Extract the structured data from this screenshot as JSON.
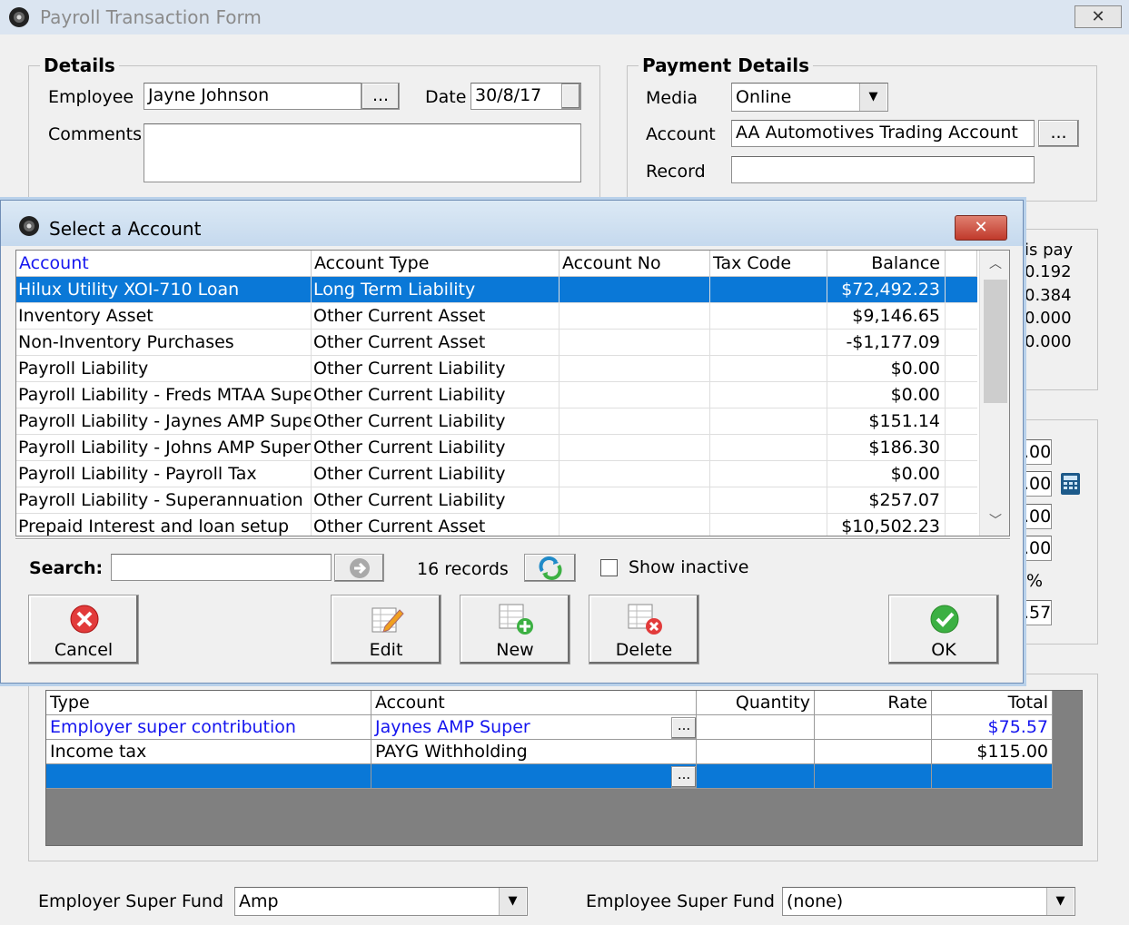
{
  "window": {
    "title": "Payroll Transaction Form",
    "close_glyph": "✕"
  },
  "details": {
    "legend": "Details",
    "employee_label": "Employee",
    "employee_value": "Jayne Johnson",
    "browse_glyph": "...",
    "date_label": "Date",
    "date_value": "30/8/17",
    "comments_label": "Comments",
    "comments_value": ""
  },
  "payment": {
    "legend": "Payment Details",
    "media_label": "Media",
    "media_value": "Online",
    "account_label": "Account",
    "account_value": "AA Automotives Trading Account",
    "record_label": "Record",
    "record_value": ""
  },
  "background_fragments": {
    "pay_header": "is pay",
    "pay_values": [
      "0.192",
      "0.384",
      "0.000",
      "0.000"
    ],
    "amount_values": [
      ".00",
      ".00",
      ".00",
      ".00",
      "%",
      ".57"
    ]
  },
  "dialog": {
    "title": "Select a Account",
    "close_glyph": "✕",
    "columns": [
      "Account",
      "Account Type",
      "Account No",
      "Tax Code",
      "Balance"
    ],
    "rows": [
      {
        "account": "Hilux Utility XOI-710 Loan",
        "type": "Long Term Liability",
        "no": "",
        "tax": "",
        "balance": "$72,492.23",
        "selected": true
      },
      {
        "account": "Inventory Asset",
        "type": "Other Current Asset",
        "no": "",
        "tax": "",
        "balance": "$9,146.65"
      },
      {
        "account": "Non-Inventory Purchases",
        "type": "Other Current Asset",
        "no": "",
        "tax": "",
        "balance": "-$1,177.09"
      },
      {
        "account": "Payroll Liability",
        "type": "Other Current Liability",
        "no": "",
        "tax": "",
        "balance": "$0.00"
      },
      {
        "account": "Payroll Liability - Freds MTAA Super",
        "type": "Other Current Liability",
        "no": "",
        "tax": "",
        "balance": "$0.00"
      },
      {
        "account": "Payroll Liability - Jaynes AMP Super",
        "type": "Other Current Liability",
        "no": "",
        "tax": "",
        "balance": "$151.14"
      },
      {
        "account": "Payroll Liability - Johns AMP Super",
        "type": "Other Current Liability",
        "no": "",
        "tax": "",
        "balance": "$186.30"
      },
      {
        "account": "Payroll Liability - Payroll Tax",
        "type": "Other Current Liability",
        "no": "",
        "tax": "",
        "balance": "$0.00"
      },
      {
        "account": "Payroll Liability - Superannuation",
        "type": "Other Current Liability",
        "no": "",
        "tax": "",
        "balance": "$257.07"
      },
      {
        "account": "Prepaid Interest and loan setup",
        "type": "Other Current Asset",
        "no": "",
        "tax": "",
        "balance": "$10,502.23"
      }
    ],
    "search_label": "Search:",
    "search_value": "",
    "record_count": "16 records",
    "show_inactive_label": "Show inactive",
    "show_inactive_checked": false,
    "buttons": {
      "cancel": "Cancel",
      "edit": "Edit",
      "new": "New",
      "delete": "Delete",
      "ok": "OK"
    }
  },
  "lines_table": {
    "columns": [
      "Type",
      "Account",
      "Quantity",
      "Rate",
      "Total"
    ],
    "rows": [
      {
        "type": "Employer super contribution",
        "account": "Jaynes AMP Super",
        "quantity": "",
        "rate": "",
        "total": "$75.57",
        "link": true
      },
      {
        "type": "Income tax",
        "account": "PAYG Withholding",
        "quantity": "",
        "rate": "",
        "total": "$115.00",
        "link": false
      },
      {
        "type": "",
        "account": "",
        "quantity": "",
        "rate": "",
        "total": "",
        "selected": true
      }
    ]
  },
  "footer": {
    "employer_fund_label": "Employer Super Fund",
    "employer_fund_value": "Amp",
    "employee_fund_label": "Employee Super Fund",
    "employee_fund_value": "(none)"
  },
  "colors": {
    "selection": "#0a78d7",
    "link": "#1515ef",
    "title_bar": "#dbe5f1"
  },
  "icons": [
    "app-icon",
    "ellipsis-browse-icon",
    "dropdown-arrow-icon",
    "go-arrow-icon",
    "refresh-icon",
    "cancel-icon",
    "edit-icon",
    "new-icon",
    "delete-icon",
    "ok-icon",
    "calculator-icon"
  ]
}
